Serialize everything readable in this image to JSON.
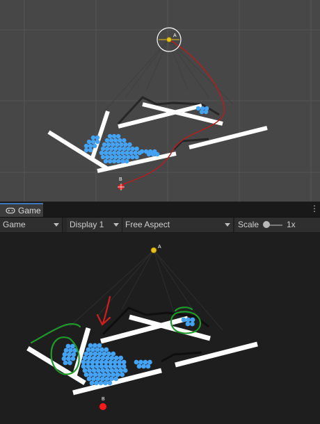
{
  "scene": {
    "anchor_label": "A",
    "end_label": "B",
    "colors": {
      "background": "#474747",
      "grid": "#545454",
      "path": "#b41e1e",
      "anchor": "#e8c21a",
      "end": "#ff1a1a",
      "ball": "#45a3f5",
      "bar": "#ffffff"
    }
  },
  "game_tab": {
    "tab_label": "Game",
    "tab_icon": "gamepad-icon",
    "menu_icon": "more-vertical-icon",
    "toolbar": {
      "view_select": "Game",
      "display_select": "Display 1",
      "aspect_select": "Free Aspect",
      "scale_label": "Scale",
      "scale_value": "1x"
    }
  },
  "game_view": {
    "anchor_label": "A",
    "end_label": "B",
    "annotations": [
      "green-circle",
      "green-circle",
      "green-stroke",
      "red-arrow"
    ],
    "colors": {
      "background": "#1e1e1e",
      "annotation_green": "#1f9a2a",
      "annotation_red": "#d11f1f",
      "ball": "#45a3f5"
    }
  }
}
